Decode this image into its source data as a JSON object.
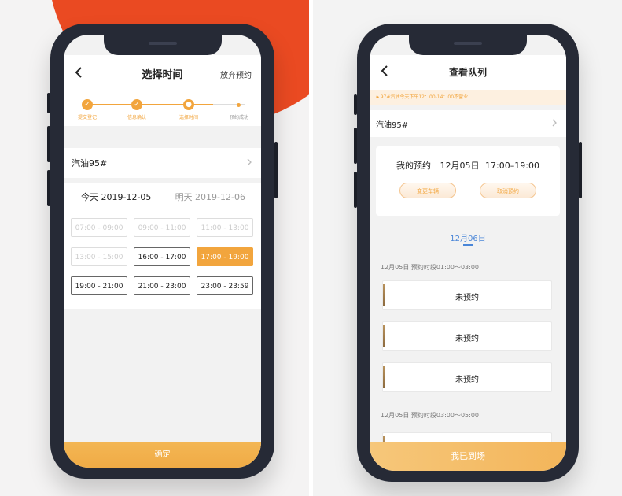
{
  "left": {
    "header": {
      "title": "选择时间",
      "right_link": "放弃预约"
    },
    "steps": [
      {
        "label": "提交登记",
        "state": "done"
      },
      {
        "label": "信息确认",
        "state": "done"
      },
      {
        "label": "选择时间",
        "state": "current"
      },
      {
        "label": "预约成功",
        "state": "pending"
      }
    ],
    "fuel": "汽油95#",
    "days": {
      "today": "今天 2019-12-05",
      "tomorrow": "明天 2019-12-06"
    },
    "slots": [
      {
        "time": "07:00 - 09:00",
        "state": "disabled"
      },
      {
        "time": "09:00 - 11:00",
        "state": "disabled"
      },
      {
        "time": "11:00 - 13:00",
        "state": "disabled"
      },
      {
        "time": "13:00 - 15:00",
        "state": "disabled"
      },
      {
        "time": "16:00 - 17:00",
        "state": "available"
      },
      {
        "time": "17:00 - 19:00",
        "state": "selected"
      },
      {
        "time": "19:00 - 21:00",
        "state": "available"
      },
      {
        "time": "21:00 - 23:00",
        "state": "available"
      },
      {
        "time": "23:00 - 23:59",
        "state": "available"
      }
    ],
    "confirm_label": "确定"
  },
  "right": {
    "header": {
      "title": "查看队列"
    },
    "notice": "97#汽油今天下午12：00-14：00不营业",
    "fuel": "汽油95#",
    "reservation": {
      "label": "我的预约",
      "date": "12月05日",
      "time": "17:00–19:00",
      "change_button": "变更车辆",
      "cancel_button": "取消预约"
    },
    "date_tab": "12月06日",
    "periods": [
      {
        "label": "12月05日 预约时段01:00～03:00",
        "items": [
          "未预约",
          "未预约",
          "未预约"
        ]
      },
      {
        "label": "12月05日 预约时段03:00～05:00",
        "items": []
      }
    ],
    "arrived_button": "我已到场"
  },
  "colors": {
    "accent": "#f2a53d",
    "blue": "#4a86d8",
    "phone": "#262a36",
    "red": "#ea4a22"
  }
}
